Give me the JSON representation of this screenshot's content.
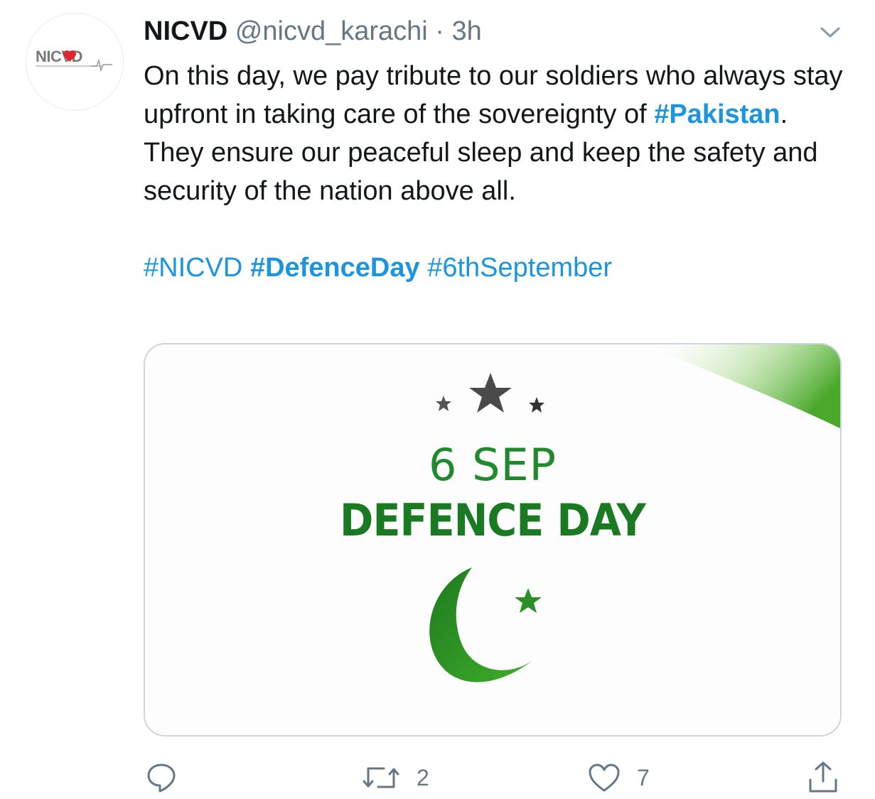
{
  "tweet": {
    "author": {
      "name": "NICVD",
      "handle": "@nicvd_karachi",
      "separator": "·",
      "time": "3h",
      "avatar_logo_text": "NICVD",
      "avatar_icon": "nicvd-logo-icon"
    },
    "menu_icon": "chevron-down-icon",
    "text": {
      "part1": "On this day, we pay tribute to our soldiers who always stay upfront in taking care of the sovereignty of ",
      "hashtag_main": "#Pakistan",
      "part2": ". They ensure our peaceful sleep and keep the safety and security of the nation above all."
    },
    "hashtags": {
      "tag1": "#NICVD",
      "tag2": "#DefenceDay",
      "tag3": "#6thSeptember"
    },
    "media": {
      "line1": "6 SEP",
      "line2": "DEFENCE DAY",
      "colors": {
        "green": "#1e8a2c",
        "light_green": "#58b03a",
        "star_grey": "#555555"
      }
    },
    "actions": {
      "reply": {
        "icon": "reply-icon",
        "count": ""
      },
      "retweet": {
        "icon": "retweet-icon",
        "count": "2"
      },
      "like": {
        "icon": "heart-icon",
        "count": "7"
      },
      "share": {
        "icon": "share-icon"
      }
    },
    "colors": {
      "link": "#1b95e0",
      "muted": "#657786",
      "text": "#14171a"
    }
  }
}
